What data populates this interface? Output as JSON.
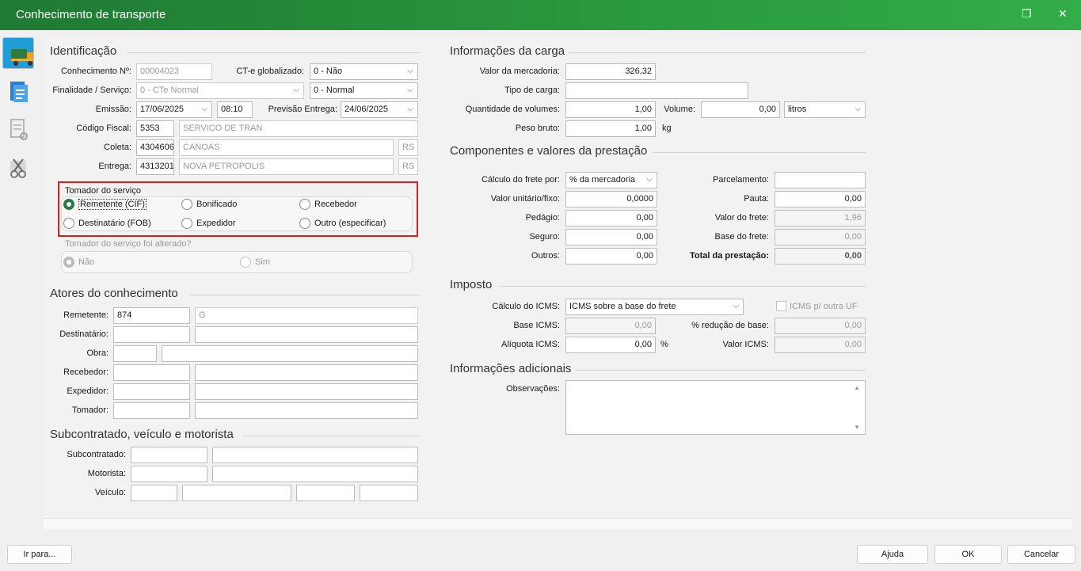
{
  "window": {
    "title": "Conhecimento de transporte",
    "restore_icon": "restore-icon",
    "close_icon": "close-icon"
  },
  "sidebar": {
    "items": [
      {
        "icon": "truck-icon",
        "selected": true
      },
      {
        "icon": "document-icon",
        "selected": false
      },
      {
        "icon": "document-settings-icon",
        "selected": false
      },
      {
        "icon": "cut-tool-icon",
        "selected": false
      }
    ]
  },
  "identificacao": {
    "title": "Identificação",
    "conhecimento_label": "Conhecimento Nº:",
    "conhecimento_value": "00004023",
    "ctg_label": "CT-e globalizado:",
    "ctg_value": "0 - Não",
    "finalidade_label": "Finalidade / Serviço:",
    "finalidade_value": "0 - CTe Normal",
    "servico_value": "0 - Normal",
    "emissao_label": "Emissão:",
    "emissao_date": "17/06/2025",
    "emissao_time": "08:10",
    "previsao_label": "Previsão Entrega:",
    "previsao_date": "24/06/2025",
    "cfop_label": "Código Fiscal:",
    "cfop_code": "5353",
    "cfop_desc": "SERVICO DE TRAN",
    "coleta_label": "Coleta:",
    "coleta_code": "4304606",
    "coleta_city": "CANOAS",
    "coleta_uf": "RS",
    "entrega_label": "Entrega:",
    "entrega_code": "4313201",
    "entrega_city": "NOVA PETROPOLIS",
    "entrega_uf": "RS"
  },
  "tomador": {
    "title": "Tomador do serviço",
    "options": [
      "Remetente (CIF)",
      "Bonificado",
      "Recebedor",
      "Destinatário (FOB)",
      "Expedidor",
      "Outro (especificar)"
    ],
    "selected": "Remetente (CIF)",
    "alterado_title": "Tomador do serviço foi alterado?",
    "alterado_options": [
      "Não",
      "Sim"
    ]
  },
  "atores": {
    "title": "Atores do conhecimento",
    "remetente_label": "Remetente:",
    "remetente_code": "874",
    "remetente_name": "G",
    "destinatario_label": "Destinatário:",
    "obra_label": "Obra:",
    "recebedor_label": "Recebedor:",
    "expedidor_label": "Expedidor:",
    "tomador_label": "Tomador:"
  },
  "subcontratado": {
    "title": "Subcontratado, veículo e motorista",
    "subcontratado_label": "Subcontratado:",
    "motorista_label": "Motorista:",
    "veiculo_label": "Veículo:"
  },
  "carga": {
    "title": "Informações da carga",
    "valor_label": "Valor da mercadoria:",
    "valor_value": "326,32",
    "tipo_label": "Tipo de carga:",
    "qtd_label": "Quantidade de volumes:",
    "qtd_value": "1,00",
    "volume_label": "Volume:",
    "volume_value": "0,00",
    "volume_unit": "litros",
    "peso_label": "Peso bruto:",
    "peso_value": "1,00",
    "peso_unit": "kg"
  },
  "componentes": {
    "title": "Componentes e valores da prestação",
    "calculo_label": "Cálculo do frete por:",
    "calculo_value": "% da mercadoria",
    "parcelamento_label": "Parcelamento:",
    "valor_unit_label": "Valor unitário/fixo:",
    "valor_unit_value": "0,0000",
    "pauta_label": "Pauta:",
    "pauta_value": "0,00",
    "pedagio_label": "Pedágio:",
    "pedagio_value": "0,00",
    "valor_frete_label": "Valor do frete:",
    "valor_frete_value": "1,96",
    "seguro_label": "Seguro:",
    "seguro_value": "0,00",
    "base_frete_label": "Base do frete:",
    "base_frete_value": "0,00",
    "outros_label": "Outros:",
    "outros_value": "0,00",
    "total_label": "Total da prestação:",
    "total_value": "0,00"
  },
  "imposto": {
    "title": "Imposto",
    "calculo_label": "Cálculo do ICMS:",
    "calculo_value": "ICMS sobre a base do frete",
    "outra_uf_label": "ICMS p/ outra UF",
    "base_label": "Base ICMS:",
    "base_value": "0,00",
    "reducao_label": "% redução de base:",
    "reducao_value": "0,00",
    "aliquota_label": "Alíquota ICMS:",
    "aliquota_value": "0,00",
    "aliquota_unit": "%",
    "valor_label": "Valor ICMS:",
    "valor_value": "0,00"
  },
  "adicionais": {
    "title": "Informações adicionais",
    "obs_label": "Observações:"
  },
  "footer": {
    "ir_para": "Ir para...",
    "ajuda": "Ajuda",
    "ok": "OK",
    "cancelar": "Cancelar"
  }
}
